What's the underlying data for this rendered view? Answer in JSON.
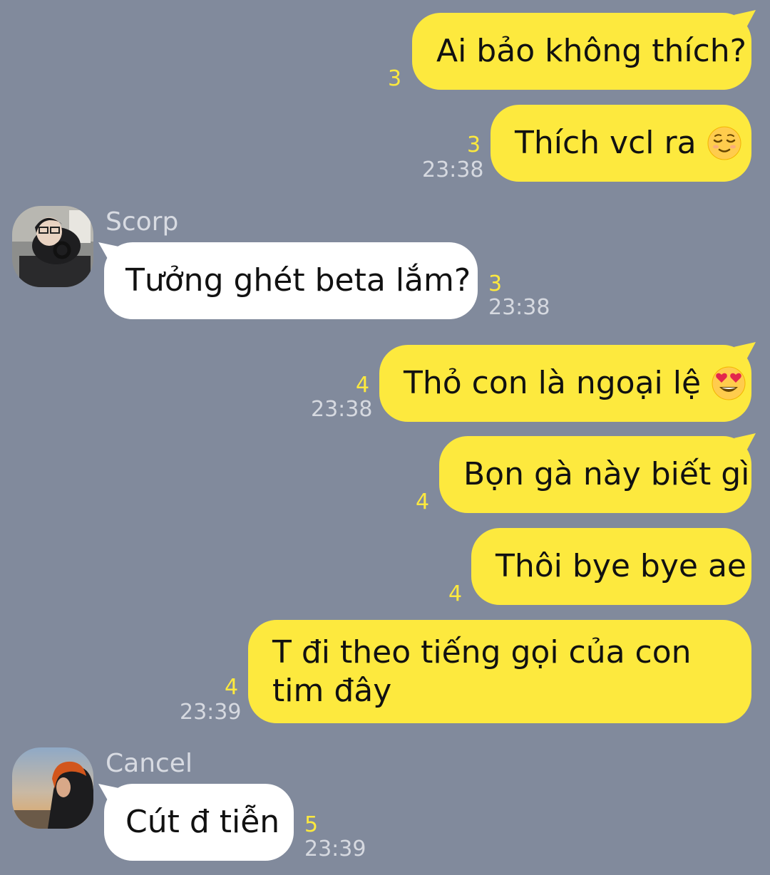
{
  "messages": [
    {
      "text": "Ai bảo không thích?",
      "count": "3",
      "time": ""
    },
    {
      "text": "Thích vcl ra",
      "emoji": "relieved-face-emoji",
      "count": "3",
      "time": "23:38"
    },
    {
      "sender": "Scorp",
      "text": "Tưởng ghét beta lắm?",
      "count": "3",
      "time": "23:38"
    },
    {
      "text": "Thỏ con là ngoại lệ",
      "emoji": "heart-eyes-emoji",
      "count": "4",
      "time": "23:38"
    },
    {
      "text": "Bọn gà này biết gì",
      "count": "4",
      "time": ""
    },
    {
      "text": "Thôi bye bye ae",
      "count": "4",
      "time": ""
    },
    {
      "text": "T đi theo tiếng gọi của con tim đây",
      "count": "4",
      "time": "23:39"
    },
    {
      "sender": "Cancel",
      "text": "Cút đ tiễn",
      "count": "5",
      "time": "23:39"
    }
  ],
  "colors": {
    "background": "#818a9c",
    "outgoing_bubble": "#fde93e",
    "incoming_bubble": "#ffffff",
    "unread_count": "#fde93e",
    "timestamp": "#d6d9e0"
  }
}
